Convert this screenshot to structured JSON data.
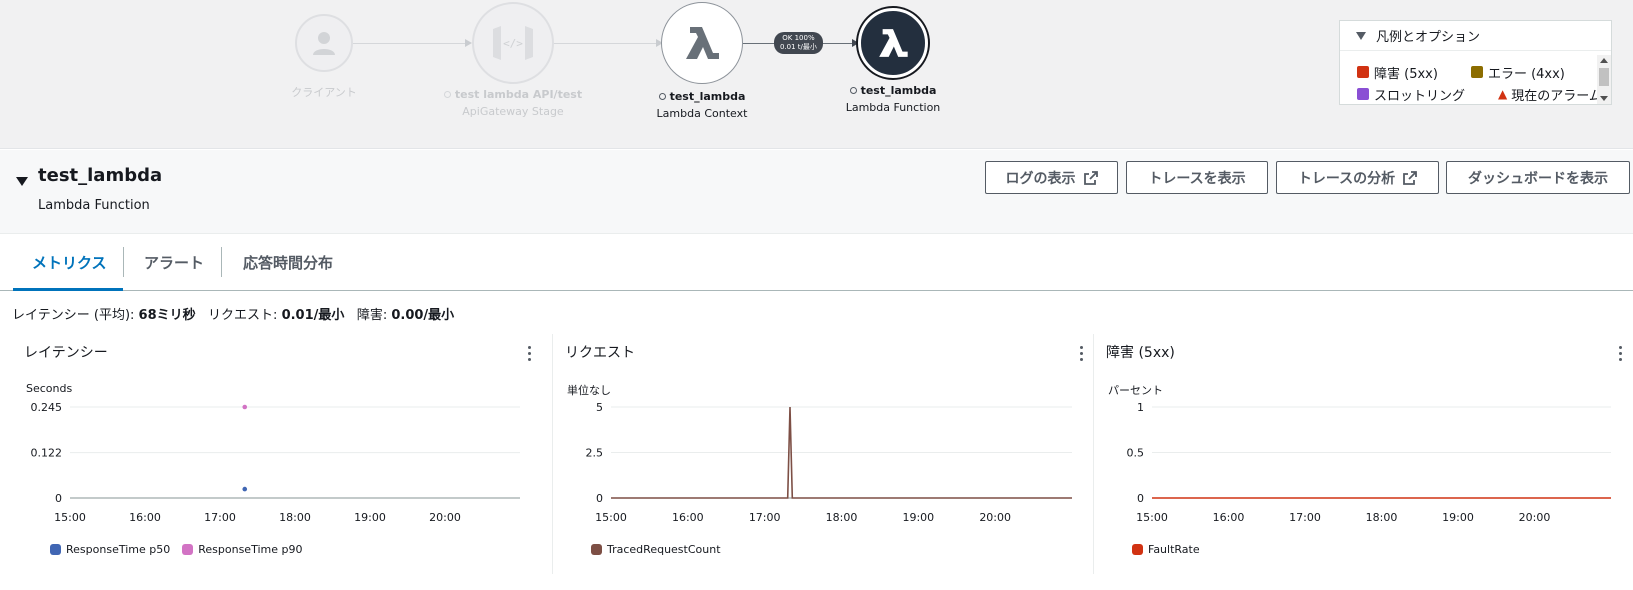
{
  "service_map": {
    "nodes": [
      {
        "id": "client",
        "name": "",
        "label": "クライアント"
      },
      {
        "id": "apigw",
        "name": "test lambda API/test",
        "label": "ApiGateway Stage"
      },
      {
        "id": "ctx",
        "name": "test_lambda",
        "label": "Lambda Context"
      },
      {
        "id": "fn",
        "name": "test_lambda",
        "label": "Lambda Function"
      }
    ],
    "edge_badge": {
      "line1": "OK 100%",
      "line2": "0.01 t/最小"
    },
    "colors": {
      "function_node": "#232f3e",
      "edge_active": "#414750"
    }
  },
  "legend_panel": {
    "title": "凡例とオプション",
    "items": [
      {
        "label": "障害 (5xx)",
        "color": "#d13212"
      },
      {
        "label": "エラー (4xx)",
        "color": "#8c6d00"
      },
      {
        "label": "スロットリング",
        "color": "#8a4fd4"
      },
      {
        "label": "現在のアラーム",
        "color": "#d13212"
      }
    ]
  },
  "detail": {
    "title": "test_lambda",
    "subtitle": "Lambda Function",
    "buttons": [
      {
        "label": "ログの表示",
        "external": true
      },
      {
        "label": "トレースを表示",
        "external": false
      },
      {
        "label": "トレースの分析",
        "external": true
      },
      {
        "label": "ダッシュボードを表示",
        "external": false
      }
    ]
  },
  "tabs": [
    {
      "label": "メトリクス",
      "active": true
    },
    {
      "label": "アラート",
      "active": false
    },
    {
      "label": "応答時間分布",
      "active": false
    }
  ],
  "summary": {
    "latency_label": "レイテンシー (平均):",
    "latency_value": "68ミリ秒",
    "request_label": "リクエスト:",
    "request_value": "0.01/最小",
    "fault_label": "障害:",
    "fault_value": "0.00/最小"
  },
  "chart_data": [
    {
      "type": "scatter",
      "title": "レイテンシー",
      "ylabel": "Seconds",
      "xticks": [
        "15:00",
        "16:00",
        "17:00",
        "18:00",
        "19:00",
        "20:00"
      ],
      "yticks": [
        "0",
        "0.122",
        "0.245"
      ],
      "xlim": [
        15.0,
        21.0
      ],
      "ylim": [
        0,
        0.245
      ],
      "series": [
        {
          "name": "ResponseTime p50",
          "color": "#4066b3",
          "points": [
            [
              17.33,
              0.024
            ]
          ]
        },
        {
          "name": "ResponseTime p90",
          "color": "#d273c4",
          "points": [
            [
              17.33,
              0.245
            ]
          ]
        }
      ]
    },
    {
      "type": "line",
      "title": "リクエスト",
      "ylabel": "単位なし",
      "xticks": [
        "15:00",
        "16:00",
        "17:00",
        "18:00",
        "19:00",
        "20:00"
      ],
      "yticks": [
        "0",
        "2.5",
        "5"
      ],
      "xlim": [
        15.0,
        21.0
      ],
      "ylim": [
        0,
        5
      ],
      "series": [
        {
          "name": "TracedRequestCount",
          "color": "#7d4f45",
          "points": [
            [
              15.0,
              0
            ],
            [
              17.3,
              0
            ],
            [
              17.33,
              5
            ],
            [
              17.36,
              0
            ],
            [
              21.0,
              0
            ]
          ]
        }
      ]
    },
    {
      "type": "line",
      "title": "障害 (5xx)",
      "ylabel": "パーセント",
      "xticks": [
        "15:00",
        "16:00",
        "17:00",
        "18:00",
        "19:00",
        "20:00"
      ],
      "yticks": [
        "0",
        "0.5",
        "1"
      ],
      "xlim": [
        15.0,
        21.0
      ],
      "ylim": [
        0,
        1
      ],
      "series": [
        {
          "name": "FaultRate",
          "color": "#d13212",
          "points": [
            [
              15.0,
              0
            ],
            [
              21.0,
              0
            ]
          ]
        }
      ]
    }
  ]
}
